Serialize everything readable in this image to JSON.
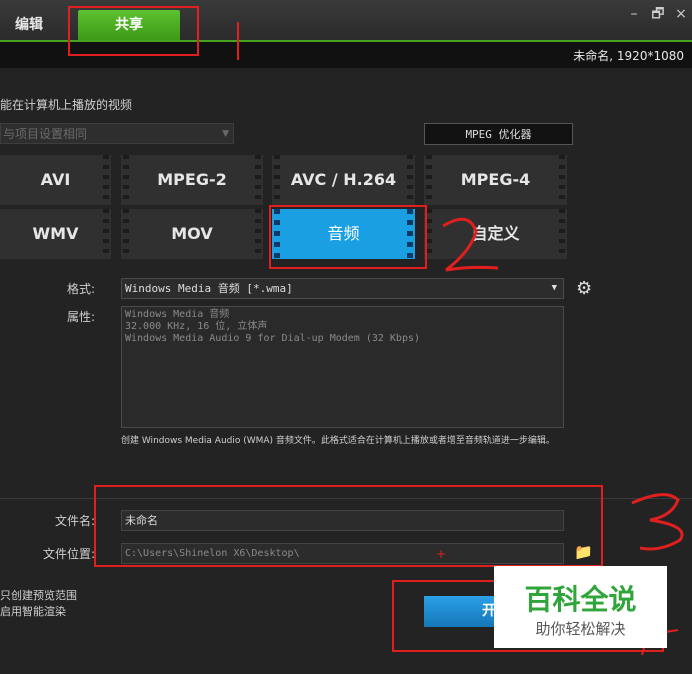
{
  "tabs": {
    "edit": "编辑",
    "share": "共享"
  },
  "window": {
    "minimize": "–",
    "restore": "🗗",
    "close": "×"
  },
  "project": {
    "info": "未命名, 1920*1080"
  },
  "section_title": "能在计算机上播放的视频",
  "preset_select": {
    "value": "与项目设置相同"
  },
  "mpeg_optimizer": "MPEG 优化器",
  "format_tiles": [
    "AVI",
    "MPEG-2",
    "AVC / H.264",
    "MPEG-4",
    "WMV",
    "MOV",
    "音频",
    "自定义"
  ],
  "selected_tile": "音频",
  "format": {
    "label": "格式:",
    "value": "Windows Media 音频 [*.wma]"
  },
  "properties": {
    "label": "属性:",
    "lines": "Windows Media 音频\n32.000 KHz, 16 位, 立体声\nWindows Media Audio 9 for Dial-up Modem (32 Kbps)"
  },
  "description": "创建 Windows Media Audio (WMA) 音频文件。此格式适合在计算机上播放或者增至音频轨道进一步编辑。",
  "file": {
    "name_label": "文件名:",
    "name_value": "未命名",
    "location_label": "文件位置:",
    "location_value": "C:\\Users\\Shinelon X6\\Desktop\\"
  },
  "options": {
    "line1": "只创建预览范围",
    "line2": "启用智能渲染"
  },
  "start_button": "开",
  "watermark": {
    "title": "百科全说",
    "subtitle": "助你轻松解决"
  },
  "colors": {
    "accent_green": "#48a323",
    "selected_blue": "#1b9fe3",
    "annotation_red": "#e0201f"
  }
}
